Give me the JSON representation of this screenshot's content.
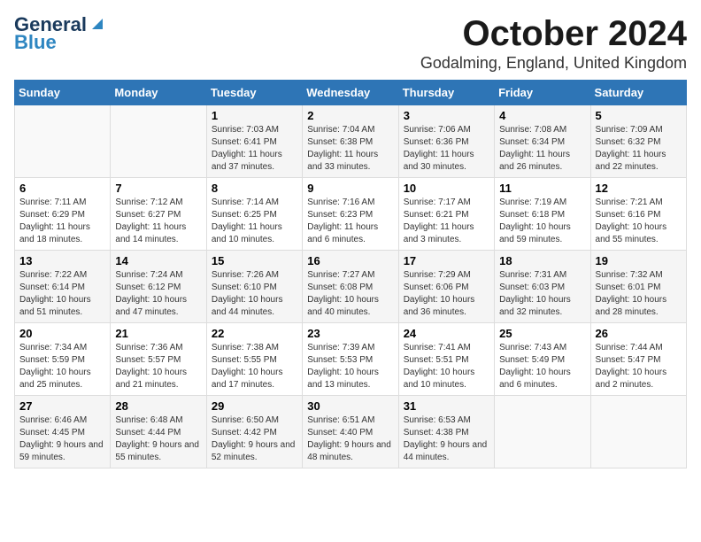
{
  "logo": {
    "line1": "General",
    "line2": "Blue"
  },
  "title": "October 2024",
  "location": "Godalming, England, United Kingdom",
  "days_of_week": [
    "Sunday",
    "Monday",
    "Tuesday",
    "Wednesday",
    "Thursday",
    "Friday",
    "Saturday"
  ],
  "weeks": [
    [
      {
        "day": "",
        "sunrise": "",
        "sunset": "",
        "daylight": ""
      },
      {
        "day": "",
        "sunrise": "",
        "sunset": "",
        "daylight": ""
      },
      {
        "day": "1",
        "sunrise": "Sunrise: 7:03 AM",
        "sunset": "Sunset: 6:41 PM",
        "daylight": "Daylight: 11 hours and 37 minutes."
      },
      {
        "day": "2",
        "sunrise": "Sunrise: 7:04 AM",
        "sunset": "Sunset: 6:38 PM",
        "daylight": "Daylight: 11 hours and 33 minutes."
      },
      {
        "day": "3",
        "sunrise": "Sunrise: 7:06 AM",
        "sunset": "Sunset: 6:36 PM",
        "daylight": "Daylight: 11 hours and 30 minutes."
      },
      {
        "day": "4",
        "sunrise": "Sunrise: 7:08 AM",
        "sunset": "Sunset: 6:34 PM",
        "daylight": "Daylight: 11 hours and 26 minutes."
      },
      {
        "day": "5",
        "sunrise": "Sunrise: 7:09 AM",
        "sunset": "Sunset: 6:32 PM",
        "daylight": "Daylight: 11 hours and 22 minutes."
      }
    ],
    [
      {
        "day": "6",
        "sunrise": "Sunrise: 7:11 AM",
        "sunset": "Sunset: 6:29 PM",
        "daylight": "Daylight: 11 hours and 18 minutes."
      },
      {
        "day": "7",
        "sunrise": "Sunrise: 7:12 AM",
        "sunset": "Sunset: 6:27 PM",
        "daylight": "Daylight: 11 hours and 14 minutes."
      },
      {
        "day": "8",
        "sunrise": "Sunrise: 7:14 AM",
        "sunset": "Sunset: 6:25 PM",
        "daylight": "Daylight: 11 hours and 10 minutes."
      },
      {
        "day": "9",
        "sunrise": "Sunrise: 7:16 AM",
        "sunset": "Sunset: 6:23 PM",
        "daylight": "Daylight: 11 hours and 6 minutes."
      },
      {
        "day": "10",
        "sunrise": "Sunrise: 7:17 AM",
        "sunset": "Sunset: 6:21 PM",
        "daylight": "Daylight: 11 hours and 3 minutes."
      },
      {
        "day": "11",
        "sunrise": "Sunrise: 7:19 AM",
        "sunset": "Sunset: 6:18 PM",
        "daylight": "Daylight: 10 hours and 59 minutes."
      },
      {
        "day": "12",
        "sunrise": "Sunrise: 7:21 AM",
        "sunset": "Sunset: 6:16 PM",
        "daylight": "Daylight: 10 hours and 55 minutes."
      }
    ],
    [
      {
        "day": "13",
        "sunrise": "Sunrise: 7:22 AM",
        "sunset": "Sunset: 6:14 PM",
        "daylight": "Daylight: 10 hours and 51 minutes."
      },
      {
        "day": "14",
        "sunrise": "Sunrise: 7:24 AM",
        "sunset": "Sunset: 6:12 PM",
        "daylight": "Daylight: 10 hours and 47 minutes."
      },
      {
        "day": "15",
        "sunrise": "Sunrise: 7:26 AM",
        "sunset": "Sunset: 6:10 PM",
        "daylight": "Daylight: 10 hours and 44 minutes."
      },
      {
        "day": "16",
        "sunrise": "Sunrise: 7:27 AM",
        "sunset": "Sunset: 6:08 PM",
        "daylight": "Daylight: 10 hours and 40 minutes."
      },
      {
        "day": "17",
        "sunrise": "Sunrise: 7:29 AM",
        "sunset": "Sunset: 6:06 PM",
        "daylight": "Daylight: 10 hours and 36 minutes."
      },
      {
        "day": "18",
        "sunrise": "Sunrise: 7:31 AM",
        "sunset": "Sunset: 6:03 PM",
        "daylight": "Daylight: 10 hours and 32 minutes."
      },
      {
        "day": "19",
        "sunrise": "Sunrise: 7:32 AM",
        "sunset": "Sunset: 6:01 PM",
        "daylight": "Daylight: 10 hours and 28 minutes."
      }
    ],
    [
      {
        "day": "20",
        "sunrise": "Sunrise: 7:34 AM",
        "sunset": "Sunset: 5:59 PM",
        "daylight": "Daylight: 10 hours and 25 minutes."
      },
      {
        "day": "21",
        "sunrise": "Sunrise: 7:36 AM",
        "sunset": "Sunset: 5:57 PM",
        "daylight": "Daylight: 10 hours and 21 minutes."
      },
      {
        "day": "22",
        "sunrise": "Sunrise: 7:38 AM",
        "sunset": "Sunset: 5:55 PM",
        "daylight": "Daylight: 10 hours and 17 minutes."
      },
      {
        "day": "23",
        "sunrise": "Sunrise: 7:39 AM",
        "sunset": "Sunset: 5:53 PM",
        "daylight": "Daylight: 10 hours and 13 minutes."
      },
      {
        "day": "24",
        "sunrise": "Sunrise: 7:41 AM",
        "sunset": "Sunset: 5:51 PM",
        "daylight": "Daylight: 10 hours and 10 minutes."
      },
      {
        "day": "25",
        "sunrise": "Sunrise: 7:43 AM",
        "sunset": "Sunset: 5:49 PM",
        "daylight": "Daylight: 10 hours and 6 minutes."
      },
      {
        "day": "26",
        "sunrise": "Sunrise: 7:44 AM",
        "sunset": "Sunset: 5:47 PM",
        "daylight": "Daylight: 10 hours and 2 minutes."
      }
    ],
    [
      {
        "day": "27",
        "sunrise": "Sunrise: 6:46 AM",
        "sunset": "Sunset: 4:45 PM",
        "daylight": "Daylight: 9 hours and 59 minutes."
      },
      {
        "day": "28",
        "sunrise": "Sunrise: 6:48 AM",
        "sunset": "Sunset: 4:44 PM",
        "daylight": "Daylight: 9 hours and 55 minutes."
      },
      {
        "day": "29",
        "sunrise": "Sunrise: 6:50 AM",
        "sunset": "Sunset: 4:42 PM",
        "daylight": "Daylight: 9 hours and 52 minutes."
      },
      {
        "day": "30",
        "sunrise": "Sunrise: 6:51 AM",
        "sunset": "Sunset: 4:40 PM",
        "daylight": "Daylight: 9 hours and 48 minutes."
      },
      {
        "day": "31",
        "sunrise": "Sunrise: 6:53 AM",
        "sunset": "Sunset: 4:38 PM",
        "daylight": "Daylight: 9 hours and 44 minutes."
      },
      {
        "day": "",
        "sunrise": "",
        "sunset": "",
        "daylight": ""
      },
      {
        "day": "",
        "sunrise": "",
        "sunset": "",
        "daylight": ""
      }
    ]
  ]
}
